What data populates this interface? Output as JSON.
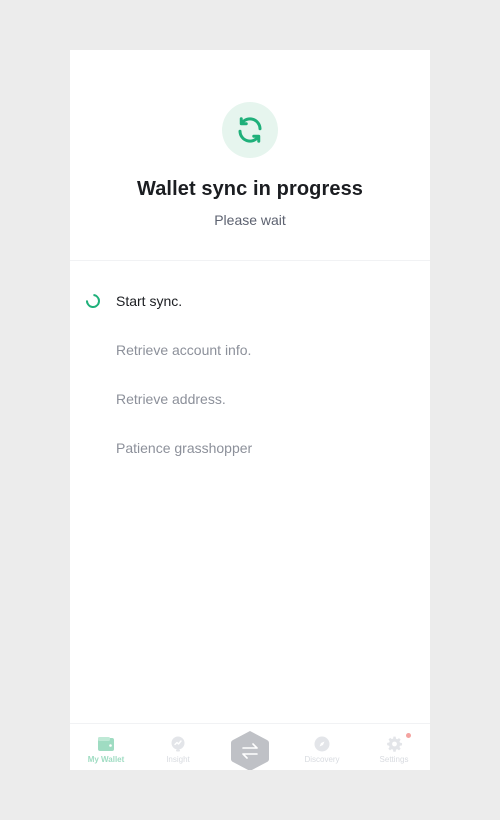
{
  "header": {
    "icon": "sync-icon",
    "title": "Wallet sync in progress",
    "subtitle": "Please wait"
  },
  "steps": [
    {
      "label": "Start sync.",
      "state": "active"
    },
    {
      "label": "Retrieve account info.",
      "state": "pending"
    },
    {
      "label": "Retrieve address.",
      "state": "pending"
    },
    {
      "label": "Patience grasshopper",
      "state": "pending"
    }
  ],
  "tabbar": {
    "tabs": [
      {
        "label": "My Wallet",
        "icon": "wallet-icon",
        "active": true
      },
      {
        "label": "Insight",
        "icon": "insight-icon",
        "active": false
      },
      {
        "label": "",
        "icon": "exchange-icon",
        "active": false
      },
      {
        "label": "Discovery",
        "icon": "compass-icon",
        "active": false
      },
      {
        "label": "Settings",
        "icon": "gear-icon",
        "active": false,
        "badge": true
      }
    ]
  },
  "colors": {
    "accent": "#1fb07a",
    "accent_soft": "#e6f5ee",
    "background": "#ececec",
    "text_primary": "#1b1d21",
    "text_muted": "#8c909a",
    "notification": "#f4a3a0"
  }
}
